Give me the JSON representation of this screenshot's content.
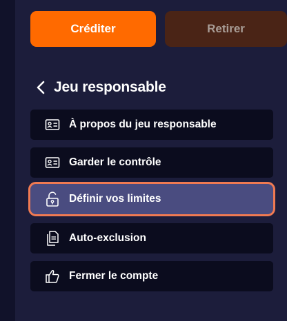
{
  "actions": {
    "credit_label": "Créditer",
    "withdraw_label": "Retirer"
  },
  "section": {
    "title": "Jeu responsable"
  },
  "menu": {
    "items": [
      {
        "label": "À propos du jeu responsable",
        "icon": "id-card-icon",
        "active": false
      },
      {
        "label": "Garder le contrôle",
        "icon": "id-card-icon",
        "active": false
      },
      {
        "label": "Définir vos limites",
        "icon": "unlock-icon",
        "active": true
      },
      {
        "label": "Auto-exclusion",
        "icon": "documents-icon",
        "active": false
      },
      {
        "label": "Fermer le compte",
        "icon": "thumbs-up-icon",
        "active": false
      }
    ]
  },
  "colors": {
    "accent": "#ff6a00",
    "active_border": "#f07a52",
    "active_bg": "#4a4c80",
    "item_bg": "#0b0c1e",
    "panel_bg": "#1c1d3b"
  }
}
